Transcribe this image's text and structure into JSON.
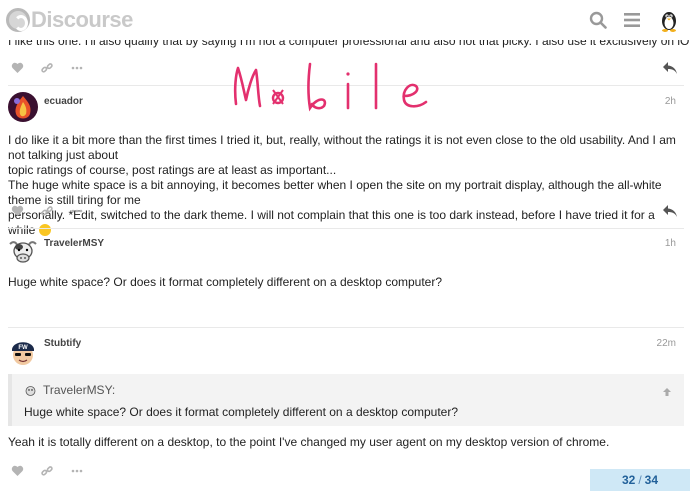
{
  "header": {
    "logo_text": "Discourse",
    "icons": [
      "search-icon",
      "hamburger-menu-icon",
      "user-avatar-tux"
    ]
  },
  "overlay_handwriting": "Mobile",
  "posts": [
    {
      "text": "I like this one. I'll also qualify that by saying I'm not a computer professional and also not that picky. I also use it exclusively on iOS."
    },
    {
      "username": "ecuador",
      "time": "2h",
      "text_line1": "I do like it a bit more than the first times I tried it, but, really, without the ratings it is not even close to the old usability. And I am not talking just about",
      "text_line2": "topic ratings of course, post ratings are at least as important...",
      "text_line3": "The huge white space is a bit annoying, it becomes better when I open the site on my portrait display, although the all-white theme is still tiring for me",
      "text_line4": "personally. *Edit, switched to the dark theme. I will not complain that this one is too dark instead, before I have tried it for a while"
    },
    {
      "username": "TravelerMSY",
      "time": "1h",
      "text": "Huge white space? Or does it format completely different on a desktop computer?"
    },
    {
      "username": "Stubtify",
      "time": "22m",
      "quote_author": "TravelerMSY:",
      "quote_text": "Huge white space? Or does it format completely different on a desktop computer?",
      "text": "Yeah it is totally different on a desktop, to the point I've changed my user agent on my desktop version of chrome."
    }
  ],
  "progress": {
    "current": "32",
    "total": "34"
  },
  "colors": {
    "accent": "#22619a",
    "progress_bg": "#cfe8f6",
    "handwriting": "#e3306e"
  }
}
